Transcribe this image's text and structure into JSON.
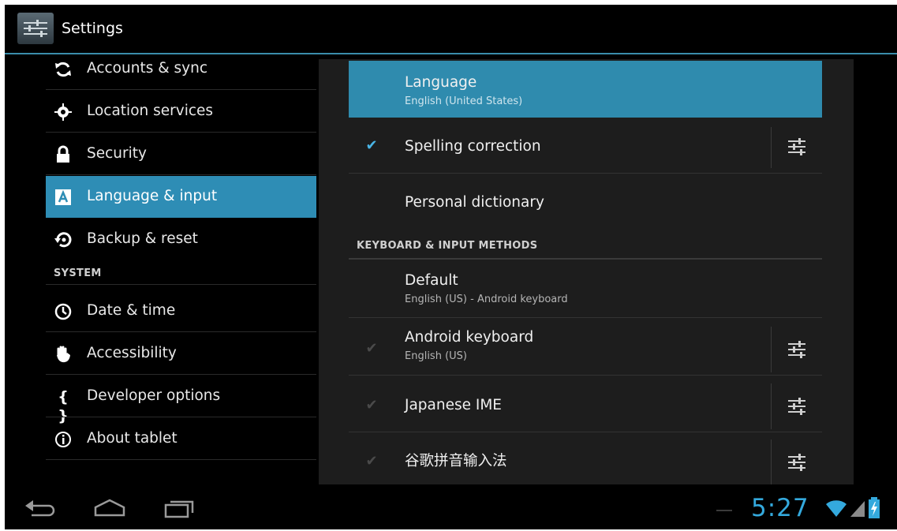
{
  "action_bar": {
    "title": "Settings",
    "icon": "settings-sliders-icon"
  },
  "sidebar": {
    "items_top": [
      {
        "label": "Accounts & sync",
        "icon": "sync-icon"
      },
      {
        "label": "Location services",
        "icon": "location-icon"
      },
      {
        "label": "Security",
        "icon": "lock-icon"
      },
      {
        "label": "Language & input",
        "icon": "language-icon",
        "active": true
      },
      {
        "label": "Backup & reset",
        "icon": "backup-icon"
      }
    ],
    "section_header": "SYSTEM",
    "items_system": [
      {
        "label": "Date & time",
        "icon": "clock-icon"
      },
      {
        "label": "Accessibility",
        "icon": "hand-icon"
      },
      {
        "label": "Developer options",
        "icon": "braces-icon"
      },
      {
        "label": "About tablet",
        "icon": "info-icon"
      }
    ]
  },
  "detail": {
    "language": {
      "title": "Language",
      "summary": "English (United States)"
    },
    "spelling": {
      "title": "Spelling correction",
      "checked": true
    },
    "dictionary": {
      "title": "Personal dictionary"
    },
    "section_header": "KEYBOARD & INPUT METHODS",
    "default": {
      "title": "Default",
      "summary": "English (US) - Android keyboard"
    },
    "android_keyboard": {
      "title": "Android keyboard",
      "summary": "English (US)",
      "checked": true
    },
    "japanese_ime": {
      "title": "Japanese IME",
      "checked": true
    },
    "pinyin": {
      "title": "谷歌拼音输入法",
      "checked": true
    }
  },
  "system_bar": {
    "clock": "5:27",
    "buttons": [
      "back-icon",
      "home-icon",
      "recent-apps-icon"
    ],
    "status_icons": [
      "wifi-icon",
      "signal-icon",
      "battery-icon"
    ]
  },
  "colors": {
    "accent": "#2e8db5",
    "holo_blue": "#33b5e5",
    "background": "#000000",
    "panel": "#1d1d1d"
  }
}
